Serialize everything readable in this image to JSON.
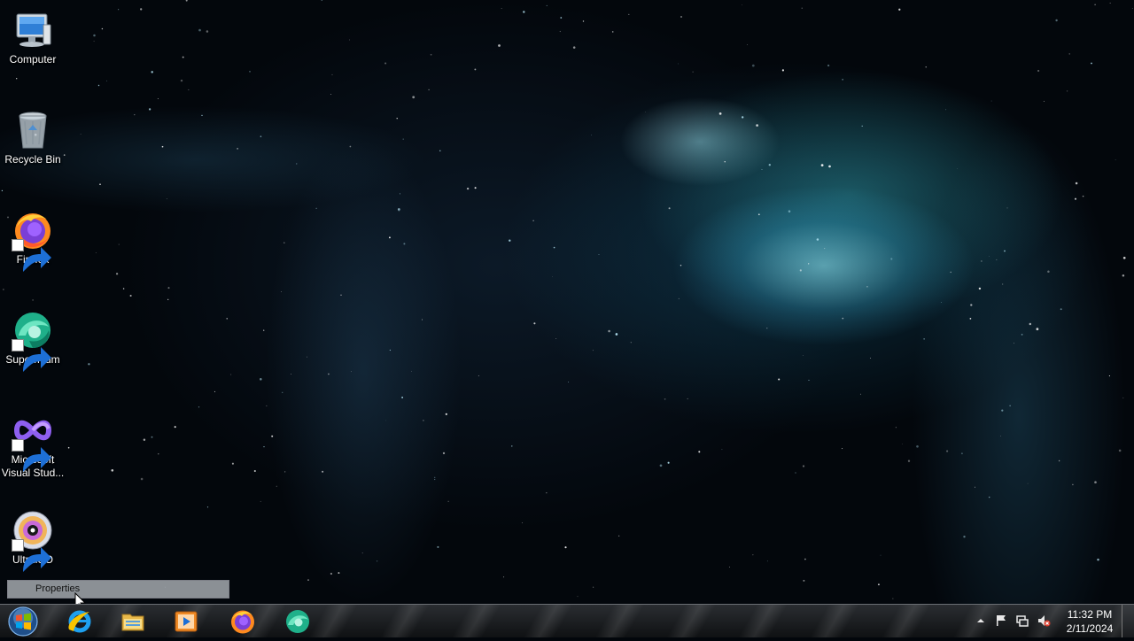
{
  "desktop": {
    "icons": [
      {
        "label": "Computer",
        "icon": "computer-icon",
        "shortcut": false
      },
      {
        "label": "Recycle Bin",
        "icon": "recycle-bin-icon",
        "shortcut": false
      },
      {
        "label": "Firefox",
        "icon": "firefox-icon",
        "shortcut": true
      },
      {
        "label": "Supermium",
        "icon": "supermium-icon",
        "shortcut": true
      },
      {
        "label": "Microsoft Visual Stud...",
        "icon": "visual-studio-icon",
        "shortcut": true
      },
      {
        "label": "UltraISO",
        "icon": "ultraiso-icon",
        "shortcut": true
      }
    ]
  },
  "context_menu": {
    "items": [
      {
        "label": "Properties"
      }
    ]
  },
  "taskbar": {
    "start": {
      "icon": "windows-logo-icon"
    },
    "pinned": [
      {
        "name": "Internet Explorer",
        "icon": "internet-explorer-icon"
      },
      {
        "name": "Windows Explorer",
        "icon": "folder-icon"
      },
      {
        "name": "Media Player",
        "icon": "media-player-icon"
      },
      {
        "name": "Firefox",
        "icon": "firefox-icon"
      },
      {
        "name": "Supermium",
        "icon": "supermium-icon"
      }
    ],
    "tray": {
      "icons": [
        "show-hidden-icons-arrow",
        "action-center-flag-icon",
        "network-icon",
        "volume-muted-icon"
      ],
      "time": "11:32 PM",
      "date": "2/11/2024"
    }
  },
  "colors": {
    "nebula": "#6fe0ff",
    "taskbar": "#1a1c1f",
    "selection": "#cdd2d7"
  }
}
